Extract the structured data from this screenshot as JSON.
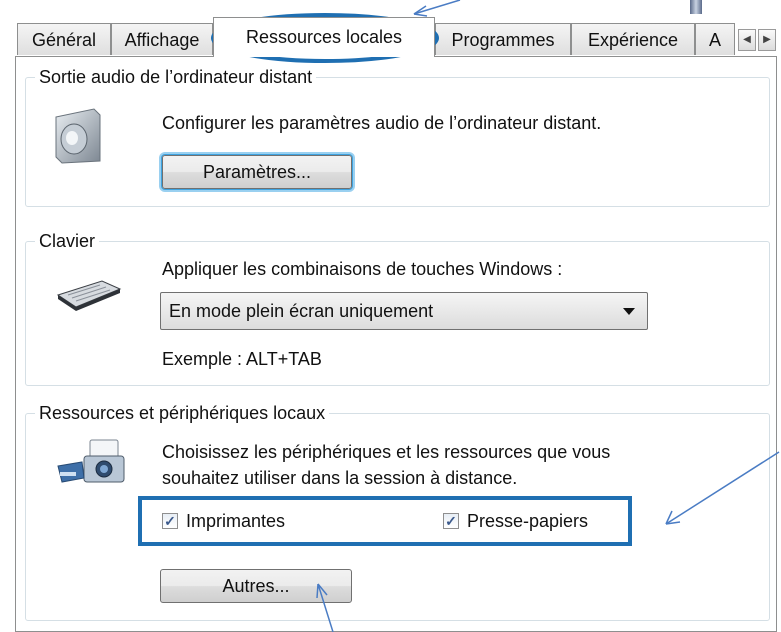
{
  "tabs": [
    {
      "label": "Général"
    },
    {
      "label": "Affichage"
    },
    {
      "label": "Ressources locales"
    },
    {
      "label": "Programmes"
    },
    {
      "label": "Expérience"
    },
    {
      "label": "A"
    }
  ],
  "audio": {
    "title": "Sortie audio de l’ordinateur distant",
    "description": "Configurer les paramètres audio de l’ordinateur distant.",
    "button_label": "Paramètres..."
  },
  "keyboard": {
    "title": "Clavier",
    "description": "Appliquer les combinaisons de touches Windows :",
    "select_value": "En mode plein écran uniquement",
    "example": "Exemple : ALT+TAB"
  },
  "local": {
    "title": "Ressources et périphériques locaux",
    "description_line1": "Choisissez les périphériques et les ressources que vous",
    "description_line2": "souhaitez utiliser dans la session à distance.",
    "printers_label": "Imprimantes",
    "printers_checked": true,
    "clipboard_label": "Presse-papiers",
    "clipboard_checked": true,
    "more_button_label": "Autres..."
  },
  "annotation_color": "#1f6fb2",
  "arrow_color": "#4a7cc4"
}
